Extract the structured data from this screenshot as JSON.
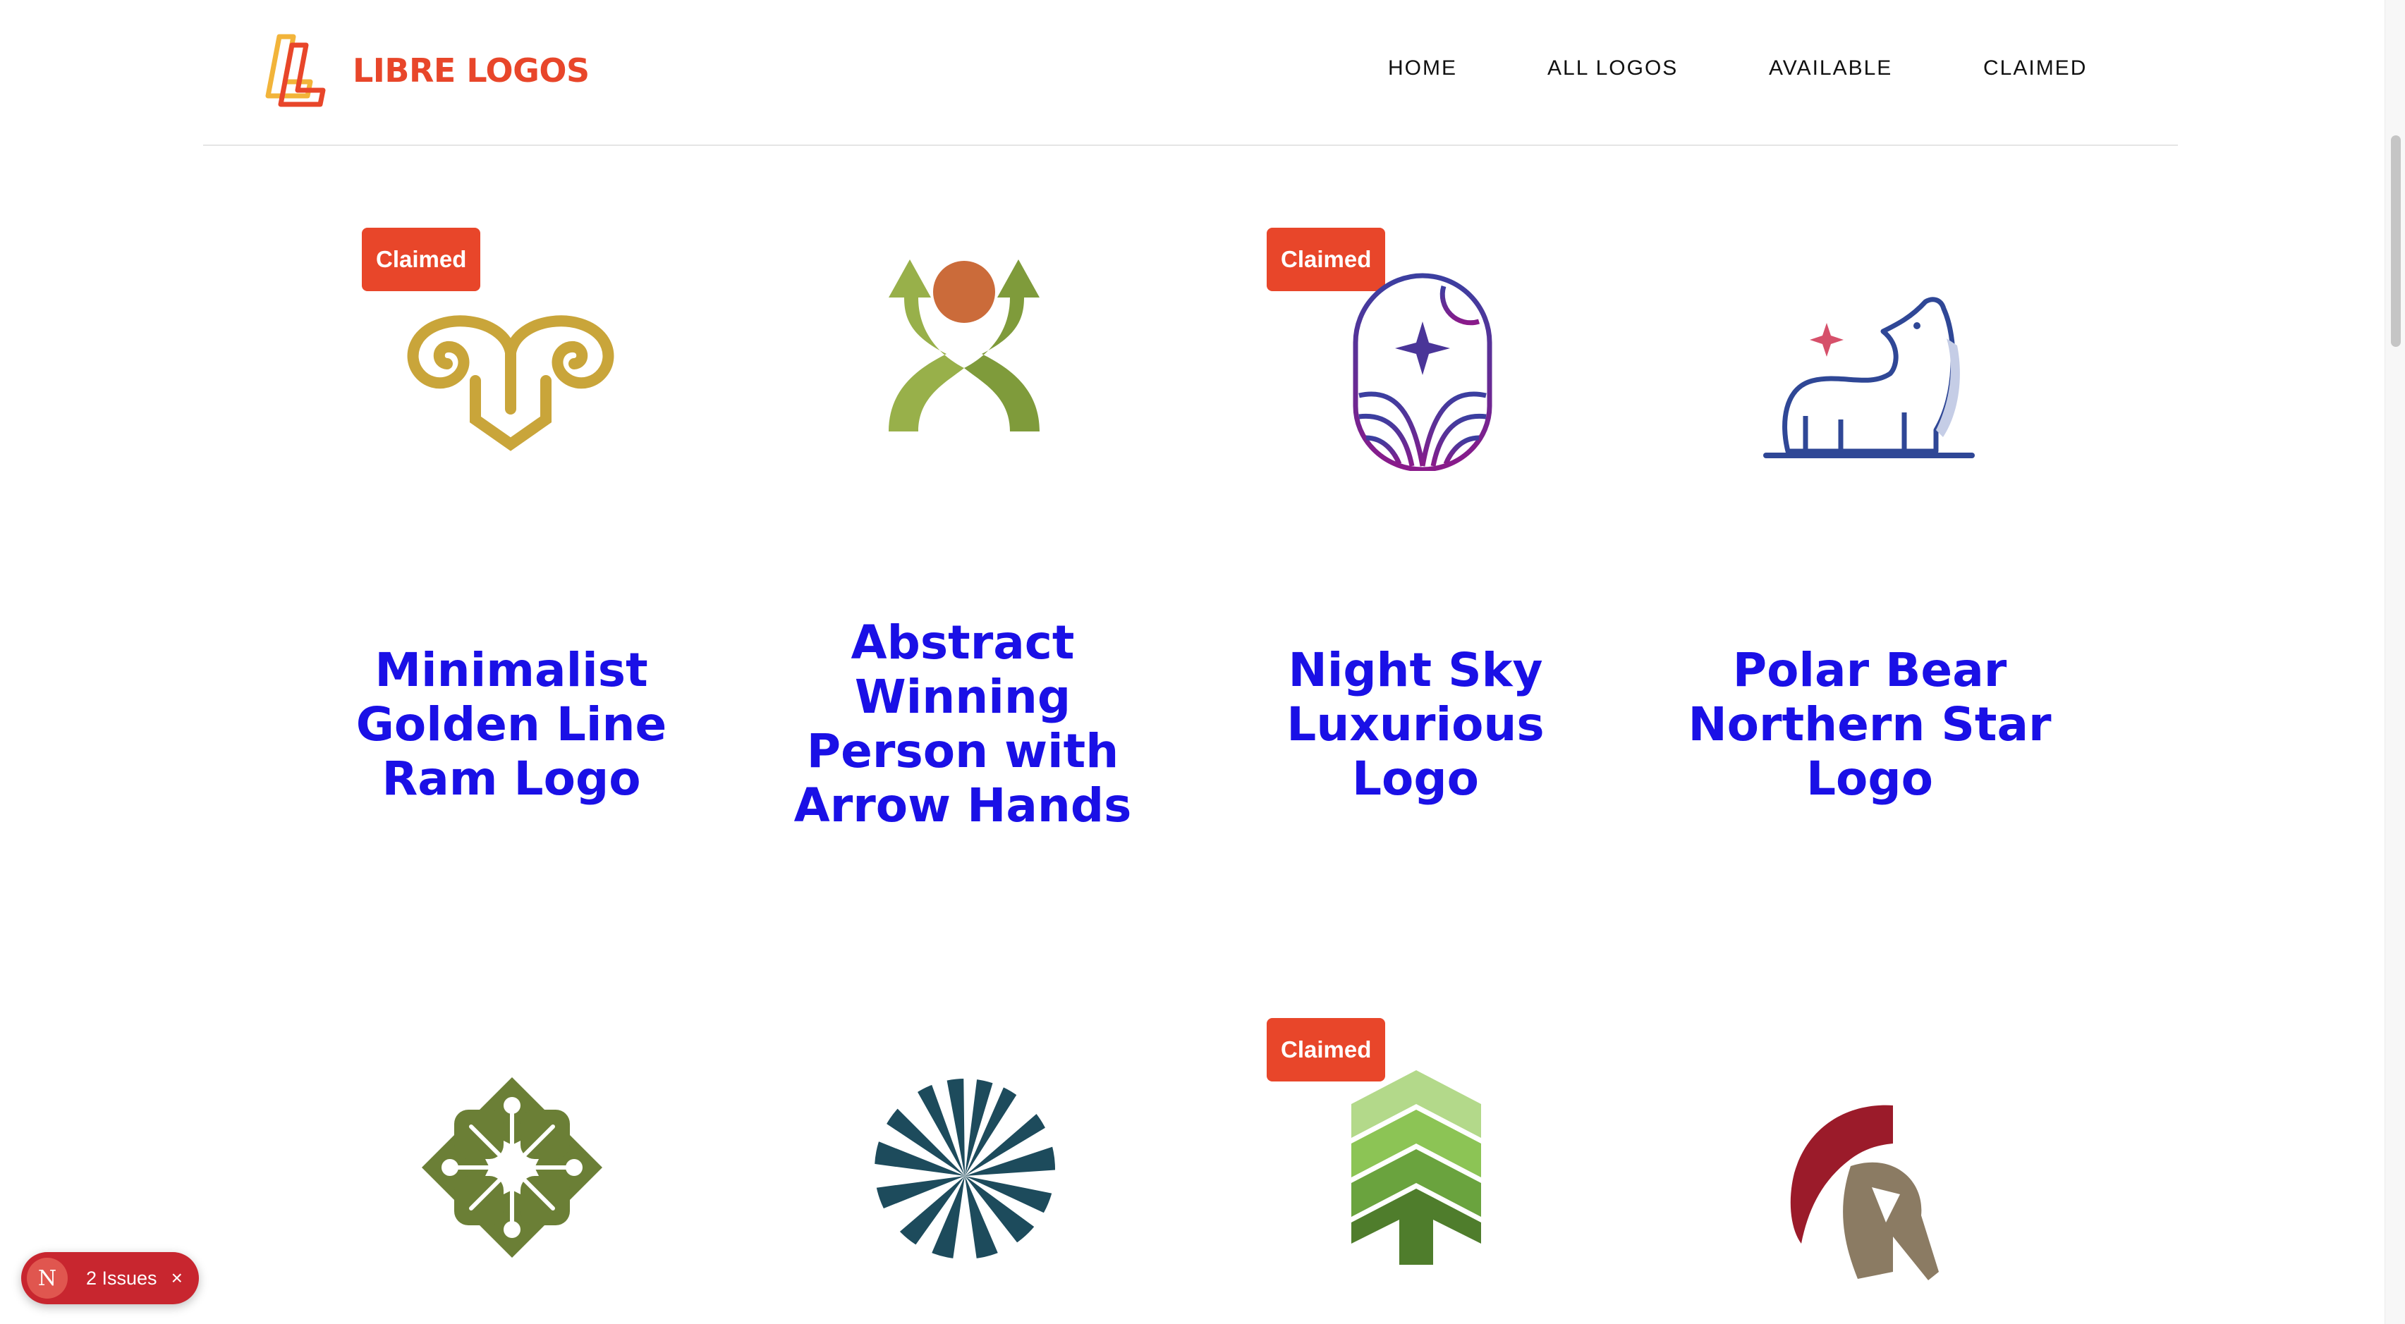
{
  "brand": {
    "name": "LIBRE LOGOS"
  },
  "nav": {
    "items": [
      "HOME",
      "ALL LOGOS",
      "AVAILABLE",
      "CLAIMED"
    ]
  },
  "cards": [
    {
      "title": "Minimalist Golden Line Ram Logo",
      "badge": "Claimed",
      "icon": "ram-horns-icon"
    },
    {
      "title": "Abstract Winning Person with Arrow Hands",
      "badge": "",
      "icon": "winning-person-icon"
    },
    {
      "title": "Night Sky Luxurious Logo",
      "badge": "Claimed",
      "icon": "night-sky-icon"
    },
    {
      "title": "Polar Bear Northern Star Logo",
      "badge": "",
      "icon": "polar-bear-icon"
    },
    {
      "title": "",
      "badge": "",
      "icon": "clover-flower-icon"
    },
    {
      "title": "",
      "badge": "",
      "icon": "radial-burst-icon"
    },
    {
      "title": "",
      "badge": "Claimed",
      "icon": "tree-arrows-icon"
    },
    {
      "title": "",
      "badge": "",
      "icon": "spartan-helmet-icon"
    }
  ],
  "issues_badge": {
    "letter": "N",
    "label": "2 Issues",
    "close": "×"
  },
  "colors": {
    "accent": "#e8462a",
    "title": "#1a10e6",
    "issues": "#c8262f"
  }
}
